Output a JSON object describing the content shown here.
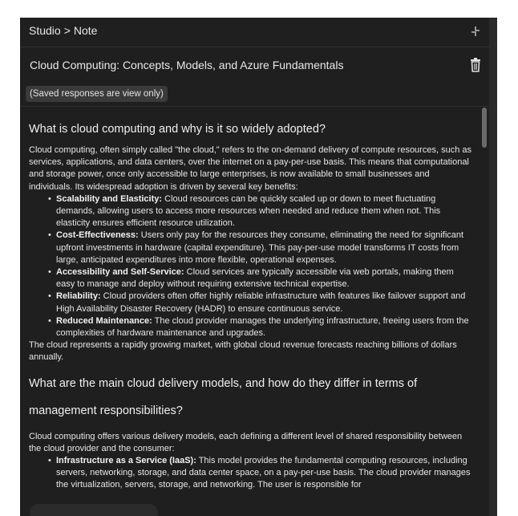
{
  "breadcrumb": {
    "parent": "Studio",
    "separator": ">",
    "current": "Note"
  },
  "icons": {
    "collapse": "collapse-content-icon",
    "delete": "trash-icon"
  },
  "note": {
    "title": "Cloud Computing: Concepts, Models, and Azure Fundamentals",
    "saved_notice": "(Saved responses are view only)"
  },
  "content": {
    "section1": {
      "heading": "What is cloud computing and why is it so widely adopted?",
      "intro": "Cloud computing, often simply called \"the cloud,\" refers to the on-demand delivery of compute resources, such as services, applications, and data centers, over the internet on a pay-per-use basis. This means that computational and storage power, once only accessible to large enterprises, is now available to small businesses and individuals. Its widespread adoption is driven by several key benefits:",
      "bullets": [
        {
          "label": "Scalability and Elasticity:",
          "text": " Cloud resources can be quickly scaled up or down to meet fluctuating demands, allowing users to access more resources when needed and reduce them when not. This elasticity ensures efficient resource utilization."
        },
        {
          "label": "Cost-Effectiveness:",
          "text": " Users only pay for the resources they consume, eliminating the need for significant upfront investments in hardware (capital expenditure). This pay-per-use model transforms IT costs from large, anticipated expenditures into more flexible, operational expenses."
        },
        {
          "label": "Accessibility and Self-Service:",
          "text": " Cloud services are typically accessible via web portals, making them easy to manage and deploy without requiring extensive technical expertise."
        },
        {
          "label": "Reliability:",
          "text": " Cloud providers often offer highly reliable infrastructure with features like failover support and High Availability Disaster Recovery (HADR) to ensure continuous service."
        },
        {
          "label": "Reduced Maintenance:",
          "text": " The cloud provider manages the underlying infrastructure, freeing users from the complexities of hardware maintenance and upgrades."
        }
      ],
      "outro": "The cloud represents a rapidly growing market, with global cloud revenue forecasts reaching billions of dollars annually."
    },
    "section2": {
      "heading": "What are the main cloud delivery models, and how do they differ in terms of management responsibilities?",
      "intro": "Cloud computing offers various delivery models, each defining a different level of shared responsibility between the cloud provider and the consumer:",
      "bullets": [
        {
          "label": "Infrastructure as a Service (IaaS):",
          "text": " This model provides the fundamental computing resources, including servers, networking, storage, and data center space, on a pay-per-use basis. The cloud provider manages the virtualization, servers, storage, and networking. The user is responsible for"
        }
      ]
    }
  }
}
